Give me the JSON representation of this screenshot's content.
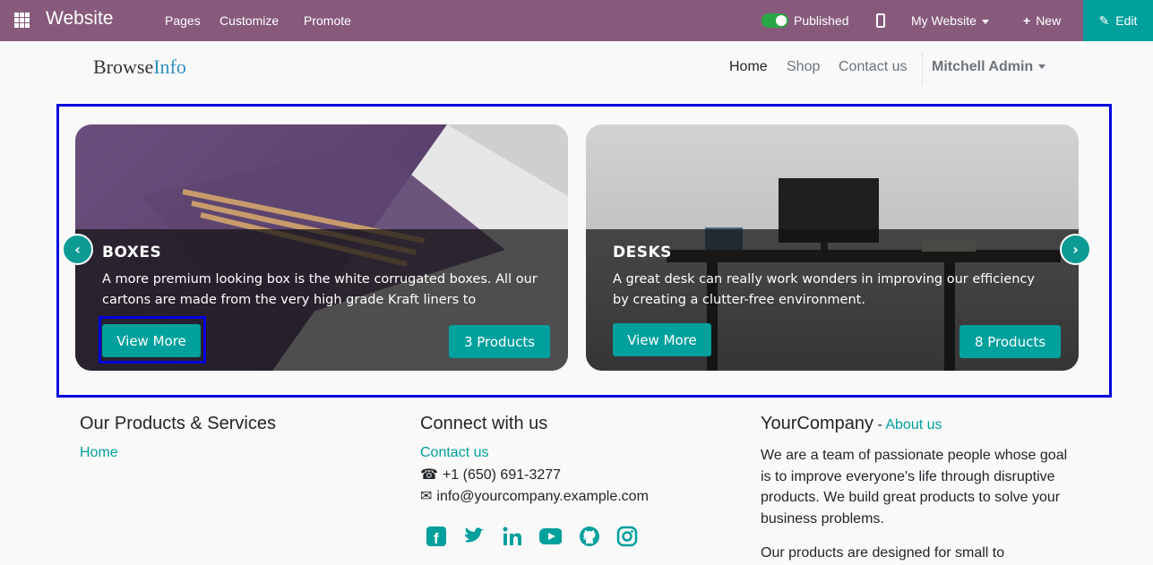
{
  "topbar": {
    "app_name": "Website",
    "nav": [
      "Pages",
      "Customize",
      "Promote"
    ],
    "published_label": "Published",
    "mobile_icon": "mobile-icon",
    "site_select": "My Website",
    "new_label": "New",
    "edit_label": "Edit",
    "colors": {
      "bar": "#875a7b",
      "edit": "#00a09d",
      "toggle": "#28a745"
    }
  },
  "header": {
    "logo_part1": "Browse",
    "logo_part2": "Info",
    "menu": [
      "Home",
      "Shop",
      "Contact us"
    ],
    "user": "Mitchell Admin"
  },
  "carousel": {
    "cards": [
      {
        "title": "BOXES",
        "description": "A more premium looking box is the white corrugated boxes. All our cartons are made from the very high grade Kraft liners to",
        "button": "View More",
        "count": "3 Products"
      },
      {
        "title": "DESKS",
        "description": "A great desk can really work wonders in improving our efficiency by creating a clutter-free environment.",
        "button": "View More",
        "count": "8 Products"
      }
    ],
    "prev_icon": "chevron-left-icon",
    "next_icon": "chevron-right-icon"
  },
  "footer": {
    "col1": {
      "heading": "Our Products & Services",
      "link": "Home"
    },
    "col2": {
      "heading": "Connect with us",
      "contact_link": "Contact us",
      "phone": "+1 (650) 691-3277",
      "email": "info@yourcompany.example.com",
      "social_icons": [
        "facebook-icon",
        "twitter-icon",
        "linkedin-icon",
        "youtube-icon",
        "github-icon",
        "instagram-icon"
      ]
    },
    "col3": {
      "company": "YourCompany",
      "separator": " - ",
      "about_link": "About us",
      "para1": "We are a team of passionate people whose goal is to improve everyone's life through disruptive products. We build great products to solve your business problems.",
      "para2": "Our products are designed for small to"
    }
  }
}
